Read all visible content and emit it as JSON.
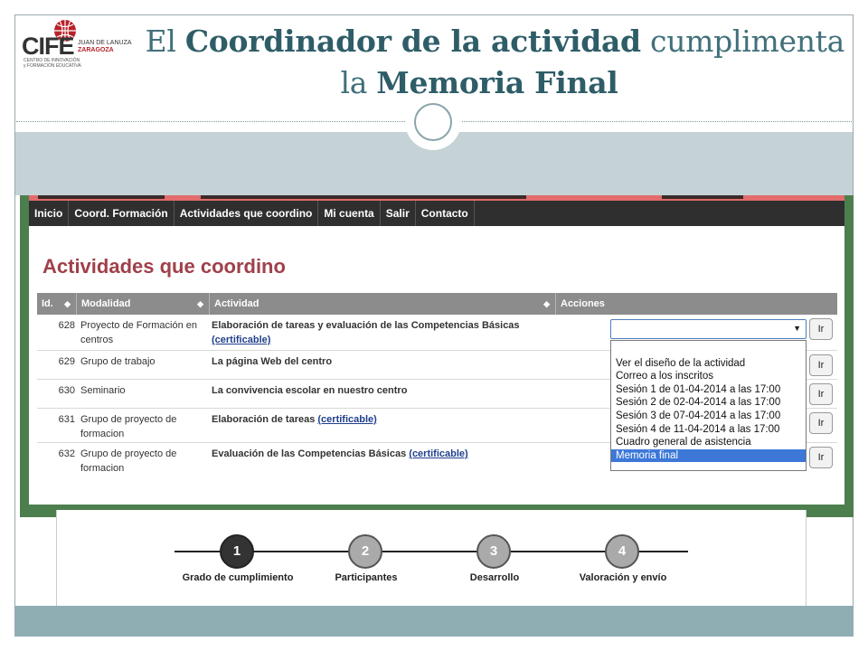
{
  "slide": {
    "title_l1_pre": "El ",
    "title_l1_bold": "Coordinador de la actividad",
    "title_l1_post": " cumplimenta",
    "title_l2_pre": "la ",
    "title_l2_bold": "Memoria Final"
  },
  "logo": {
    "cif": "CIFE",
    "line1": "JUAN DE LANUZA",
    "line2": "ZARAGOZA",
    "sub1": "CENTRO DE INNOVACIÓN",
    "sub2": "y FORMACIÓN EDUCATIVA"
  },
  "nav": [
    "Inicio",
    "Coord. Formación",
    "Actividades que coordino",
    "Mi cuenta",
    "Salir",
    "Contacto"
  ],
  "page": {
    "heading": "Actividades que coordino"
  },
  "table": {
    "headers": {
      "id": "Id.",
      "modalidad": "Modalidad",
      "actividad": "Actividad",
      "acciones": "Acciones"
    },
    "ir_label": "Ir",
    "rows": [
      {
        "id": "628",
        "modalidad": "Proyecto de Formación en centros",
        "actividad": "Elaboración de tareas y evaluación de las Competencias Básicas",
        "link": "(certificable)"
      },
      {
        "id": "629",
        "modalidad": "Grupo de trabajo",
        "actividad": "La página Web del centro",
        "link": ""
      },
      {
        "id": "630",
        "modalidad": "Seminario",
        "actividad": "La convivencia escolar en nuestro centro",
        "link": ""
      },
      {
        "id": "631",
        "modalidad": "Grupo de proyecto de formacion",
        "actividad": "Elaboración de tareas",
        "link": "(certificable)"
      },
      {
        "id": "632",
        "modalidad": "Grupo de proyecto de formacion",
        "actividad": "Evaluación de las Competencias Básicas",
        "link": "(certificable)"
      }
    ]
  },
  "dropdown": {
    "selected_value": "",
    "options": [
      "",
      "Ver el diseño de la actividad",
      "Correo a los inscritos",
      "Sesión 1 de 01-04-2014 a las 17:00",
      "Sesión 2 de 02-04-2014 a las 17:00",
      "Sesión 3 de 07-04-2014 a las 17:00",
      "Sesión 4 de 11-04-2014 a las 17:00",
      "Cuadro general de asistencia",
      "Memoria final"
    ],
    "highlighted": "Memoria final"
  },
  "wizard": {
    "steps": [
      {
        "num": "1",
        "label": "Grado de cumplimiento",
        "active": true
      },
      {
        "num": "2",
        "label": "Participantes",
        "active": false
      },
      {
        "num": "3",
        "label": "Desarrollo",
        "active": false
      },
      {
        "num": "4",
        "label": "Valoración y envío",
        "active": false
      }
    ]
  },
  "colors": {
    "title": "#41707a",
    "heading": "#a0404a",
    "navbar": "#2f2f2f",
    "highlight": "#3d78d8",
    "frame_green": "#4d7e4e"
  }
}
